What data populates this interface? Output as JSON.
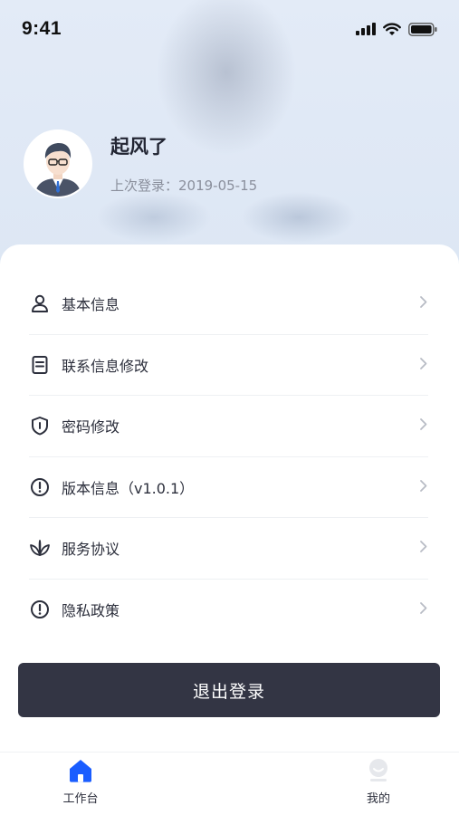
{
  "status_bar": {
    "time": "9:41"
  },
  "profile": {
    "name": "起风了",
    "last_login": "上次登录：2019-05-15",
    "avatar_icon": "avatar-icon"
  },
  "menu": {
    "items": [
      {
        "label": "基本信息",
        "icon": "user-icon"
      },
      {
        "label": "联系信息修改",
        "icon": "document-icon"
      },
      {
        "label": "密码修改",
        "icon": "shield-icon"
      },
      {
        "label": "版本信息（v1.0.1）",
        "icon": "info-icon"
      },
      {
        "label": "服务协议",
        "icon": "leaf-icon"
      },
      {
        "label": "隐私政策",
        "icon": "privacy-icon"
      }
    ]
  },
  "logout": {
    "label": "退出登录"
  },
  "tabbar": {
    "tabs": [
      {
        "label": "工作台",
        "icon": "home-icon",
        "active": true
      },
      {
        "label": "我的",
        "icon": "profile-icon",
        "active": false
      }
    ]
  },
  "colors": {
    "accent": "#1a5dff",
    "button_dark": "#333544",
    "text_primary": "#2c2f3c",
    "text_secondary": "#8a8f9c"
  }
}
